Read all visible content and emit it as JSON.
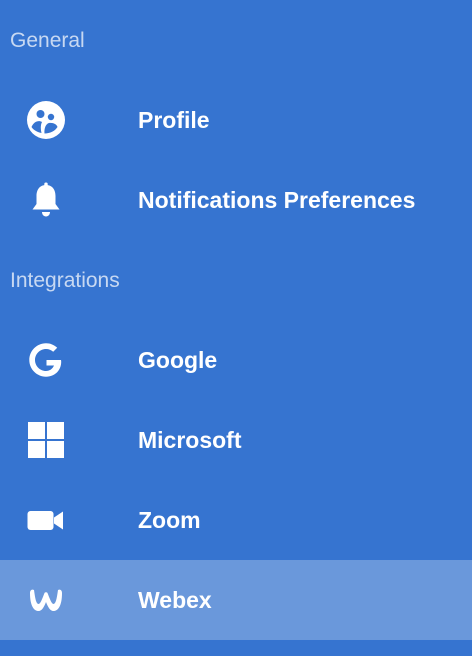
{
  "sections": {
    "general": {
      "title": "General",
      "items": [
        {
          "label": "Profile",
          "icon": "profile-face-icon"
        },
        {
          "label": "Notifications Preferences",
          "icon": "bell-icon"
        }
      ]
    },
    "integrations": {
      "title": "Integrations",
      "items": [
        {
          "label": "Google",
          "icon": "google-icon"
        },
        {
          "label": "Microsoft",
          "icon": "microsoft-icon"
        },
        {
          "label": "Zoom",
          "icon": "zoom-camera-icon"
        },
        {
          "label": "Webex",
          "icon": "webex-icon",
          "selected": true
        }
      ]
    }
  },
  "colors": {
    "background": "#3674d0",
    "selected_background": "#6a98db",
    "text": "#ffffff",
    "section_header": "#b5cdf0"
  }
}
